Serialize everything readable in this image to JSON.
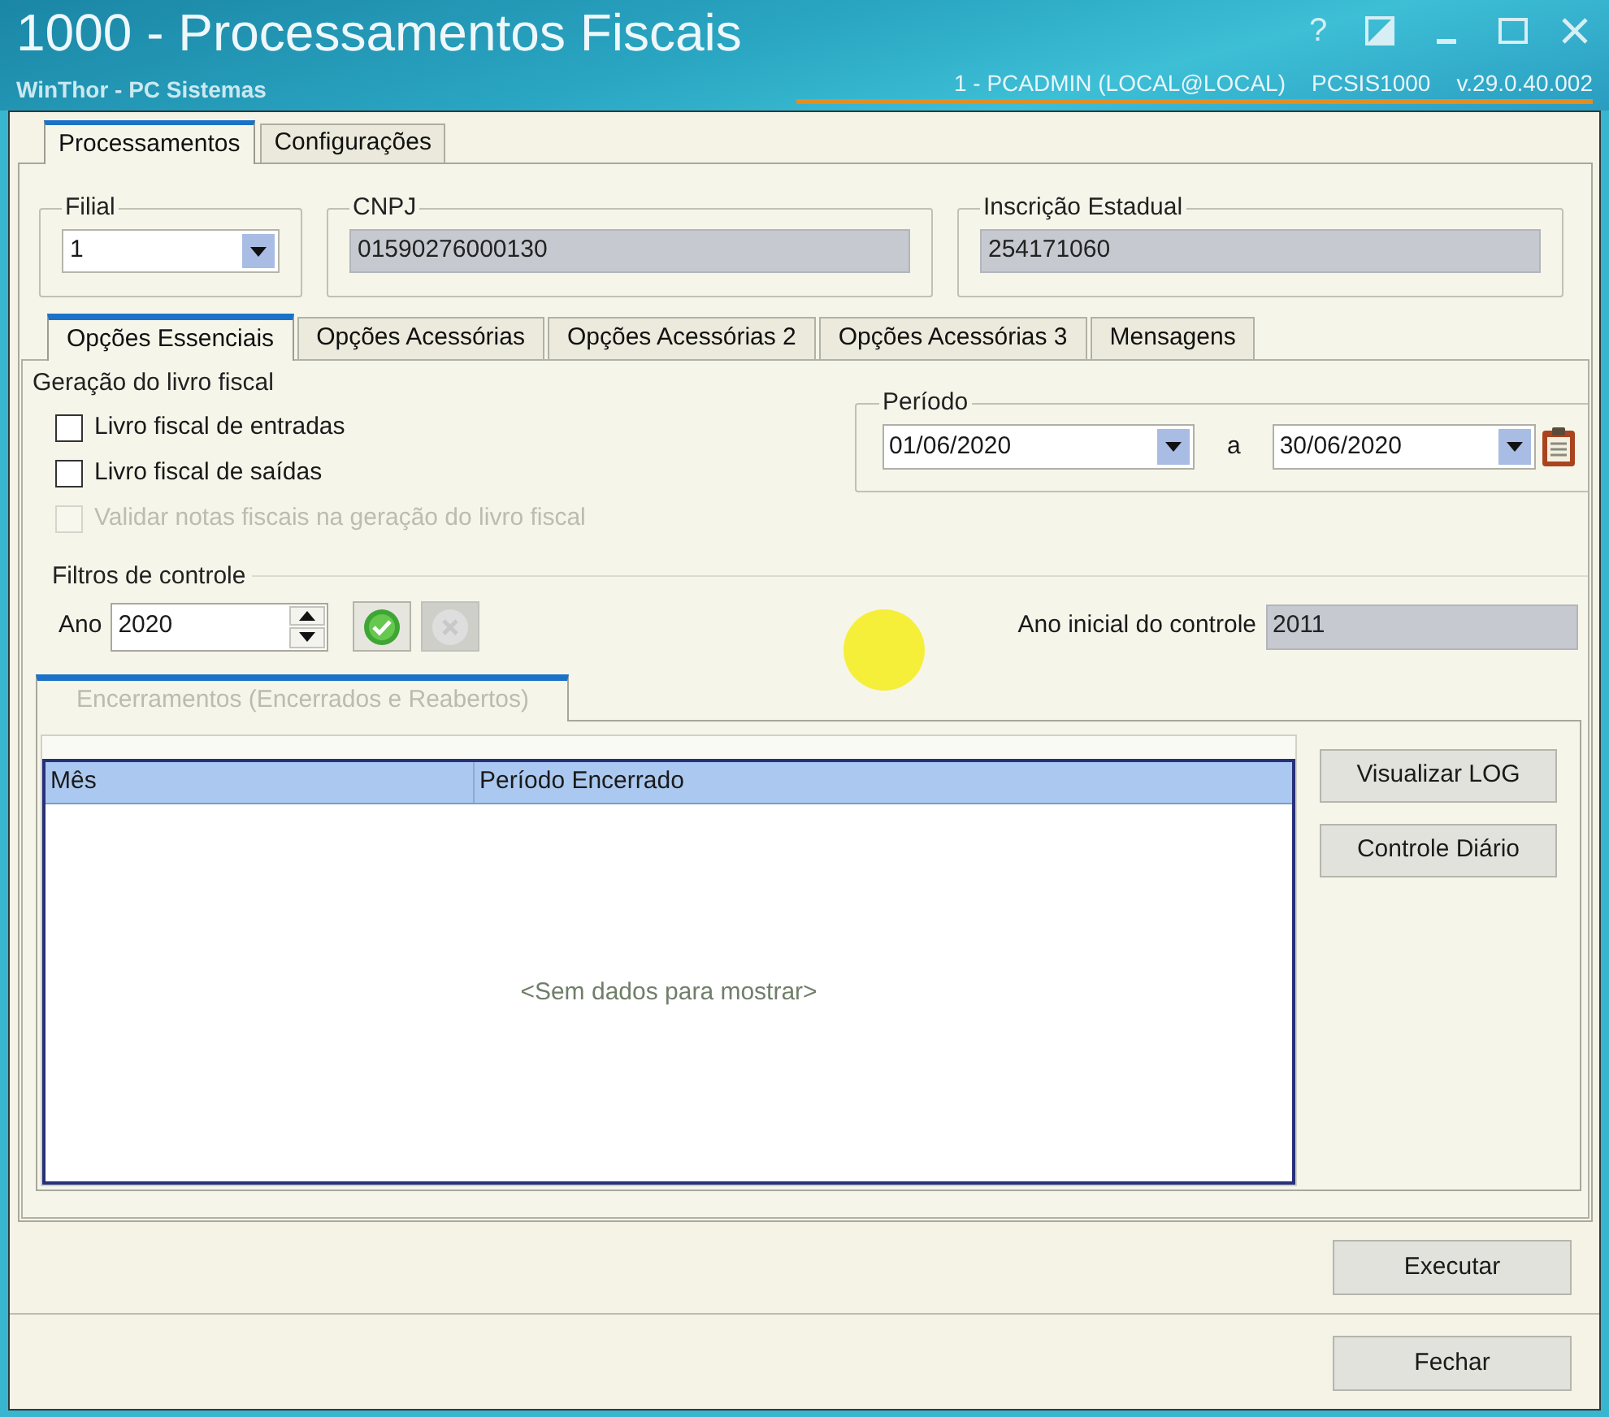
{
  "window": {
    "title": "1000 - Processamentos Fiscais",
    "help": "?",
    "subtitle": "WinThor - PC Sistemas",
    "session": [
      "1 - PCADMIN (LOCAL@LOCAL)",
      "PCSIS1000",
      "v.29.0.40.002"
    ]
  },
  "main_tabs": [
    {
      "label": "Processamentos",
      "selected": true
    },
    {
      "label": "Configurações",
      "selected": false
    }
  ],
  "header_fields": [
    {
      "kind": "dropdown",
      "label": "Filial",
      "value": "1"
    },
    {
      "kind": "readonly",
      "label": "CNPJ",
      "value": "01590276000130"
    },
    {
      "kind": "readonly",
      "label": "Inscrição Estadual",
      "value": "254171060"
    }
  ],
  "option_tabs": [
    {
      "label": "Opções Essenciais",
      "selected": true
    },
    {
      "label": "Opções Acessórias",
      "selected": false
    },
    {
      "label": "Opções Acessórias 2",
      "selected": false
    },
    {
      "label": "Opções Acessórias 3",
      "selected": false
    },
    {
      "label": "Mensagens",
      "selected": false
    }
  ],
  "livro_fiscal": {
    "title": "Geração do livro fiscal",
    "options": [
      {
        "label": "Livro fiscal de entradas",
        "checked": false,
        "disabled": false
      },
      {
        "label": "Livro fiscal de saídas",
        "checked": false,
        "disabled": false
      },
      {
        "label": "Validar notas fiscais na geração do livro fiscal",
        "checked": false,
        "disabled": true
      }
    ]
  },
  "periodo": {
    "label": "Período",
    "start": "01/06/2020",
    "separator": "a",
    "end": "30/06/2020"
  },
  "filtros": {
    "title": "Filtros de controle",
    "year_label": "Ano",
    "year_value": "2020",
    "buttons": [
      {
        "kind": "confirm",
        "disabled": false
      },
      {
        "kind": "cancel",
        "disabled": true
      }
    ],
    "initial_year_label": "Ano inicial do controle",
    "initial_year_value": "2011"
  },
  "encerramentos": {
    "tab": {
      "label": "Encerramentos (Encerrados e Reabertos)",
      "selected": true,
      "disabled": true
    },
    "columns": [
      "Mês",
      "Período Encerrado"
    ],
    "empty_message": "<Sem dados para mostrar>",
    "buttons": [
      "Visualizar LOG",
      "Controle Diário"
    ]
  },
  "footer_buttons": [
    "Executar",
    "Fechar"
  ]
}
